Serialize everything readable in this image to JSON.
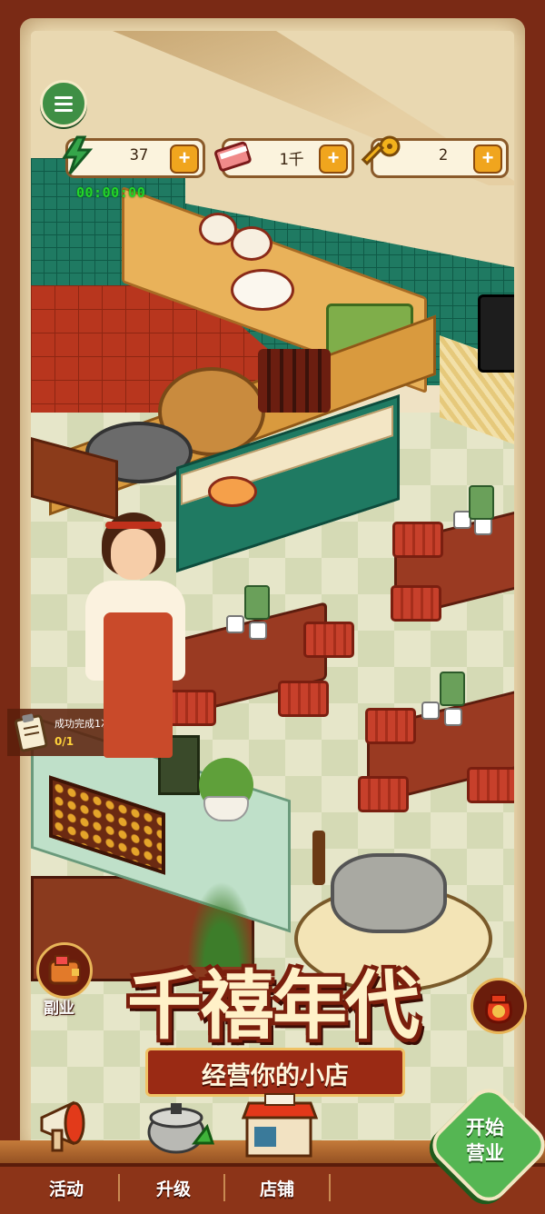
{
  "hud": {
    "energy": {
      "value": "37",
      "icon": "lightning-icon"
    },
    "money": {
      "value": "1千",
      "icon": "cash-bundle-icon"
    },
    "keys": {
      "value": "2",
      "icon": "key-icon"
    },
    "plus_label": "+",
    "timer": "00:00:00"
  },
  "quest": {
    "title": "成功完成1次营业",
    "progress": "0/1"
  },
  "side": {
    "side_business": "副业"
  },
  "title": {
    "main": "千禧年代",
    "subtitle": "经营你的小店"
  },
  "nav": {
    "activity": "活动",
    "upgrade": "升级",
    "shop": "店铺"
  },
  "start_button": {
    "line1": "开始",
    "line2": "营业"
  },
  "colors": {
    "frame": "#7a2a15",
    "tile_green": "#1f7a62",
    "start_green": "#55b653",
    "plus_orange": "#f0a51e",
    "title_cream": "#fff1c8"
  }
}
